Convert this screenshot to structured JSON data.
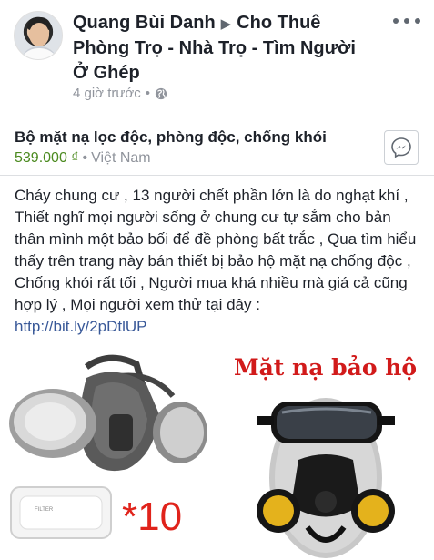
{
  "post": {
    "author": "Quang Bùi Danh",
    "group": "Cho Thuê Phòng Trọ - Nhà Trọ - Tìm Người Ở Ghép",
    "time": "4 giờ trước",
    "audience_icon": "globe-icon"
  },
  "listing": {
    "title": "Bộ mặt nạ  lọc độc, phòng độc, chống khói",
    "price": "539.000 ₫",
    "location": "Việt Nam",
    "action_icon": "messenger-icon"
  },
  "body": {
    "text": "Cháy chung cư , 13 người chết phần lớn là do nghạt khí , Thiết nghĩ mọi người sống ở chung cư tự sắm cho bản thân mình một bảo bối để đề phòng bất trắc , Qua tìm hiểu thấy trên trang này bán thiết bị bảo hộ mặt nạ chống độc , Chống khói rất tối , Người mua khá nhiều mà giá cả cũng hợp lý , Mọi người xem thử tại đây :",
    "link": "http://bit.ly/2pDtlUP"
  },
  "images": {
    "left_caption": "*10",
    "right_caption": "Mặt nạ bảo hộ"
  },
  "colors": {
    "price": "#4b8a1f",
    "link": "#385898",
    "caption_red": "#d11a1a"
  }
}
